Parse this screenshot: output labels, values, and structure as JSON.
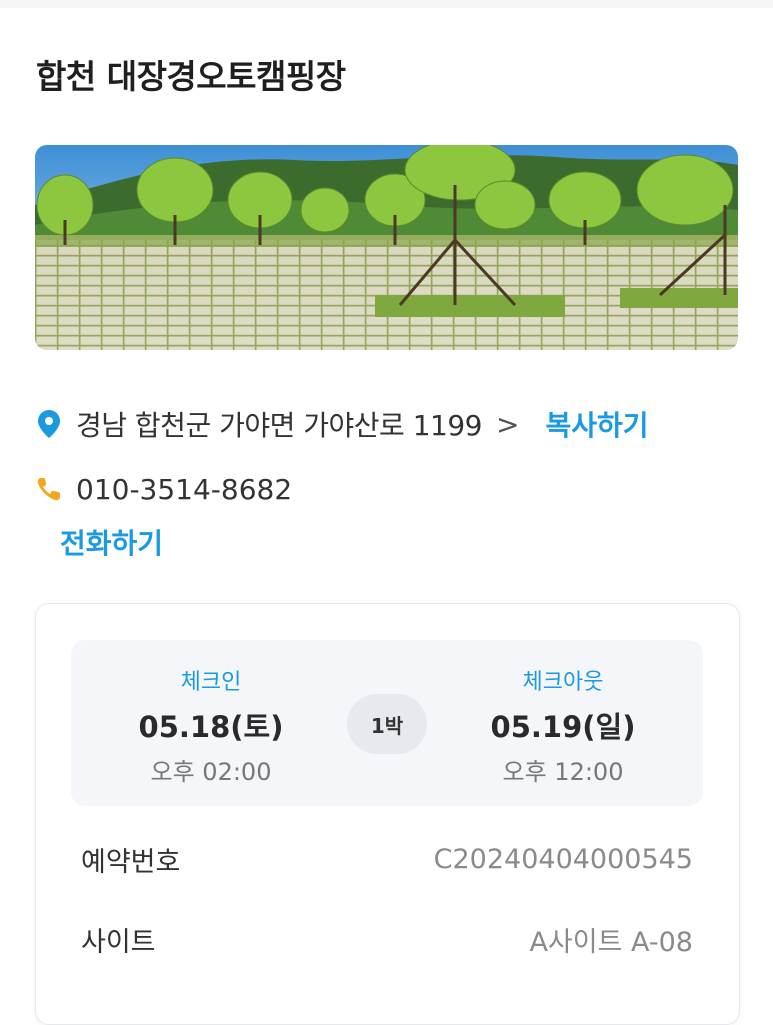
{
  "header": {
    "title": "합천 대장경오토캠핑장"
  },
  "hero": {
    "alt": "campground photo",
    "icon": "campsite-photo"
  },
  "address": {
    "icon": "location-pin-icon",
    "text": "경남 합천군 가야면 가야산로 1199",
    "chevron": ">",
    "copy_label": "복사하기",
    "accent": "#1a9ae0"
  },
  "phone": {
    "icon": "phone-icon",
    "number": "010-3514-8682",
    "call_label": "전화하기"
  },
  "reservation": {
    "checkin": {
      "label": "체크인",
      "date": "05.18(토)",
      "time": "오후 02:00"
    },
    "nights": "1박",
    "checkout": {
      "label": "체크아웃",
      "date": "05.19(일)",
      "time": "오후 12:00"
    },
    "rows": [
      {
        "key": "예약번호",
        "value": "C20240404000545"
      },
      {
        "key": "사이트",
        "value": "A사이트 A-08"
      }
    ]
  }
}
